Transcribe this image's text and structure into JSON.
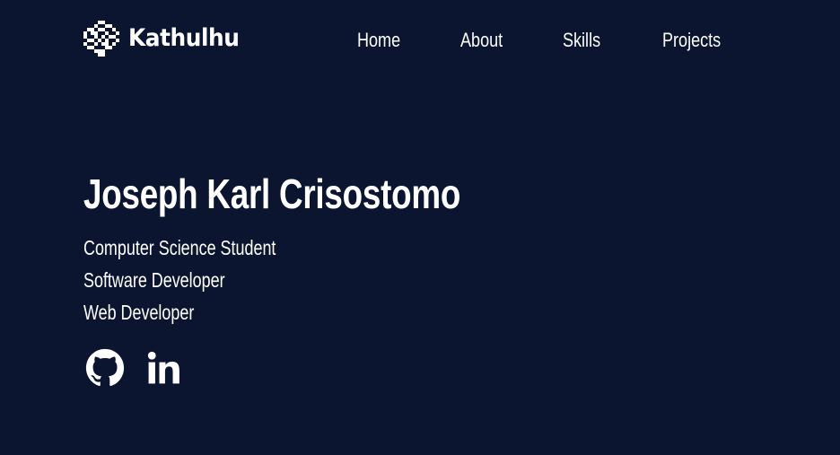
{
  "header": {
    "brand": {
      "name": "Kathulhu",
      "logo_icon": "pixel-diamond-logo-icon"
    },
    "nav": [
      {
        "label": "Home"
      },
      {
        "label": "About"
      },
      {
        "label": "Skills"
      },
      {
        "label": "Projects"
      }
    ]
  },
  "hero": {
    "name": "Joseph Karl Crisostomo",
    "roles": [
      "Computer Science Student",
      "Software Developer",
      "Web Developer"
    ],
    "socials": [
      {
        "icon": "github-icon"
      },
      {
        "icon": "linkedin-icon"
      }
    ]
  },
  "colors": {
    "background": "#0b1530",
    "text": "#ffffff"
  }
}
